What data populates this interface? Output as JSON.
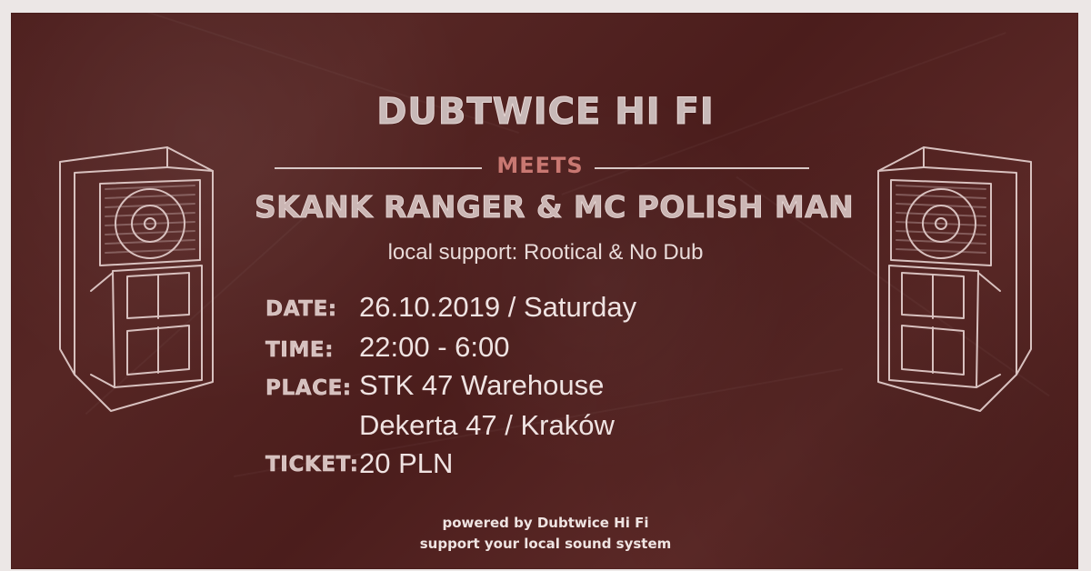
{
  "poster": {
    "title": "DUBTWICE HI FI",
    "meets": "MEETS",
    "headliner": "SKANK RANGER & MC POLISH MAN",
    "support": "local support: Rootical & No Dub",
    "details": {
      "date_label": "DATE:",
      "date_value": "26.10.2019 / Saturday",
      "time_label": "TIME:",
      "time_value": "22:00 - 6:00",
      "place_label": "PLACE:",
      "place_value_1": "STK 47 Warehouse",
      "place_value_2": "Dekerta 47 / Kraków",
      "ticket_label": "TICKET:",
      "ticket_value": "20 PLN"
    },
    "footer": {
      "line1": "powered by Dubtwice Hi Fi",
      "line2": "support your local sound system"
    },
    "colors": {
      "background": "#4d1e1d",
      "text": "#efe3e2",
      "accent": "#c97872",
      "line_art": "#d8c1bf"
    },
    "icons": [
      "speaker-left-icon",
      "speaker-right-icon"
    ]
  }
}
